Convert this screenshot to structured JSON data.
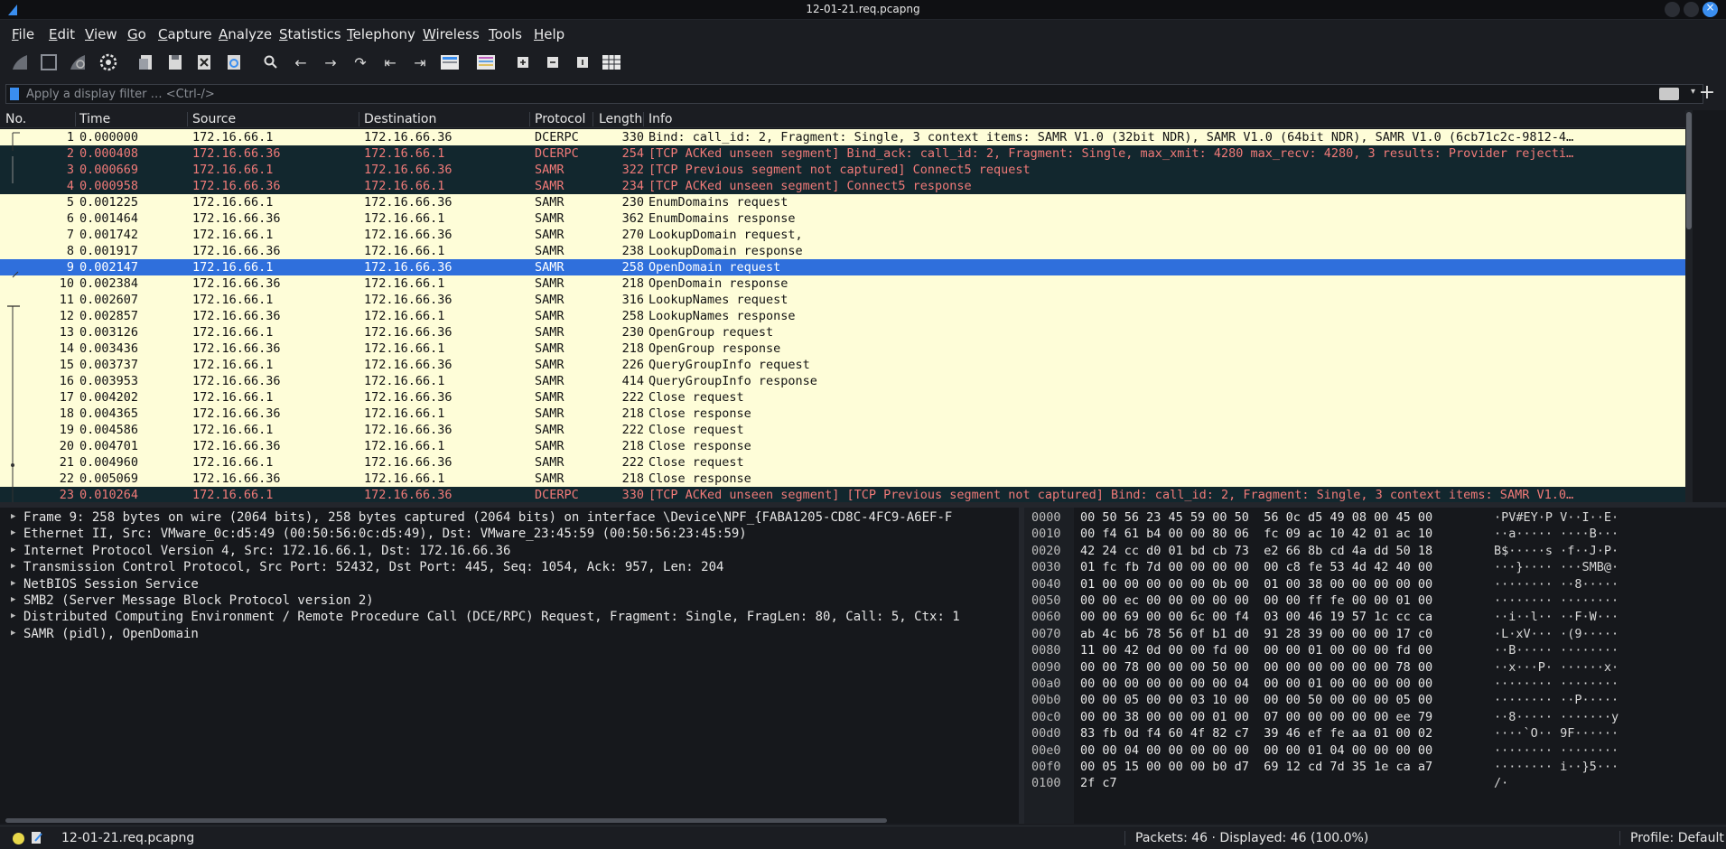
{
  "window": {
    "title": "12-01-21.req.pcapng"
  },
  "menu": [
    "File",
    "Edit",
    "View",
    "Go",
    "Capture",
    "Analyze",
    "Statistics",
    "Telephony",
    "Wireless",
    "Tools",
    "Help"
  ],
  "toolbar": {
    "icons": [
      "shark-fin-start-icon",
      "stop-square-icon",
      "shark-fin-restart-icon",
      "gear-options-icon",
      "open-file-icon",
      "save-file-icon",
      "close-file-icon",
      "reload-file-icon",
      "find-packet-icon",
      "back-arrow-icon",
      "forward-arrow-icon",
      "goto-packet-icon",
      "first-packet-icon",
      "last-packet-icon",
      "autoscroll-icon",
      "colorize-icon",
      "zoom-in-icon",
      "zoom-out-icon",
      "normal-size-icon",
      "resize-columns-icon"
    ]
  },
  "filter": {
    "placeholder": "Apply a display filter … <Ctrl-/>",
    "value": ""
  },
  "columns": [
    "No.",
    "Time",
    "Source",
    "Destination",
    "Protocol",
    "Length",
    "Info"
  ],
  "packets": [
    {
      "no": "1",
      "time": "0.000000",
      "src": "172.16.66.1",
      "dst": "172.16.66.36",
      "proto": "DCERPC",
      "len": "330",
      "info": "Bind: call_id: 2, Fragment: Single, 3 context items: SAMR V1.0 (32bit NDR), SAMR V1.0 (64bit NDR), SAMR V1.0 (6cb71c2c-9812-4…",
      "style": "yellow"
    },
    {
      "no": "2",
      "time": "0.000408",
      "src": "172.16.66.36",
      "dst": "172.16.66.1",
      "proto": "DCERPC",
      "len": "254",
      "info": "[TCP ACKed unseen segment] Bind_ack: call_id: 2, Fragment: Single, max_xmit: 4280 max_recv: 4280, 3 results: Provider rejecti…",
      "style": "dark"
    },
    {
      "no": "3",
      "time": "0.000669",
      "src": "172.16.66.1",
      "dst": "172.16.66.36",
      "proto": "SAMR",
      "len": "322",
      "info": "[TCP Previous segment not captured] Connect5 request",
      "style": "dark"
    },
    {
      "no": "4",
      "time": "0.000958",
      "src": "172.16.66.36",
      "dst": "172.16.66.1",
      "proto": "SAMR",
      "len": "234",
      "info": "[TCP ACKed unseen segment] Connect5 response",
      "style": "dark"
    },
    {
      "no": "5",
      "time": "0.001225",
      "src": "172.16.66.1",
      "dst": "172.16.66.36",
      "proto": "SAMR",
      "len": "230",
      "info": "EnumDomains request",
      "style": "yellow"
    },
    {
      "no": "6",
      "time": "0.001464",
      "src": "172.16.66.36",
      "dst": "172.16.66.1",
      "proto": "SAMR",
      "len": "362",
      "info": "EnumDomains response",
      "style": "yellow"
    },
    {
      "no": "7",
      "time": "0.001742",
      "src": "172.16.66.1",
      "dst": "172.16.66.36",
      "proto": "SAMR",
      "len": "270",
      "info": "LookupDomain request,",
      "style": "yellow"
    },
    {
      "no": "8",
      "time": "0.001917",
      "src": "172.16.66.36",
      "dst": "172.16.66.1",
      "proto": "SAMR",
      "len": "238",
      "info": "LookupDomain response",
      "style": "yellow"
    },
    {
      "no": "9",
      "time": "0.002147",
      "src": "172.16.66.1",
      "dst": "172.16.66.36",
      "proto": "SAMR",
      "len": "258",
      "info": "OpenDomain request",
      "style": "selected"
    },
    {
      "no": "10",
      "time": "0.002384",
      "src": "172.16.66.36",
      "dst": "172.16.66.1",
      "proto": "SAMR",
      "len": "218",
      "info": "OpenDomain response",
      "style": "yellow"
    },
    {
      "no": "11",
      "time": "0.002607",
      "src": "172.16.66.1",
      "dst": "172.16.66.36",
      "proto": "SAMR",
      "len": "316",
      "info": "LookupNames request",
      "style": "yellow"
    },
    {
      "no": "12",
      "time": "0.002857",
      "src": "172.16.66.36",
      "dst": "172.16.66.1",
      "proto": "SAMR",
      "len": "258",
      "info": "LookupNames response",
      "style": "yellow"
    },
    {
      "no": "13",
      "time": "0.003126",
      "src": "172.16.66.1",
      "dst": "172.16.66.36",
      "proto": "SAMR",
      "len": "230",
      "info": "OpenGroup request",
      "style": "yellow"
    },
    {
      "no": "14",
      "time": "0.003436",
      "src": "172.16.66.36",
      "dst": "172.16.66.1",
      "proto": "SAMR",
      "len": "218",
      "info": "OpenGroup response",
      "style": "yellow"
    },
    {
      "no": "15",
      "time": "0.003737",
      "src": "172.16.66.1",
      "dst": "172.16.66.36",
      "proto": "SAMR",
      "len": "226",
      "info": "QueryGroupInfo request",
      "style": "yellow"
    },
    {
      "no": "16",
      "time": "0.003953",
      "src": "172.16.66.36",
      "dst": "172.16.66.1",
      "proto": "SAMR",
      "len": "414",
      "info": "QueryGroupInfo response",
      "style": "yellow"
    },
    {
      "no": "17",
      "time": "0.004202",
      "src": "172.16.66.1",
      "dst": "172.16.66.36",
      "proto": "SAMR",
      "len": "222",
      "info": "Close request",
      "style": "yellow"
    },
    {
      "no": "18",
      "time": "0.004365",
      "src": "172.16.66.36",
      "dst": "172.16.66.1",
      "proto": "SAMR",
      "len": "218",
      "info": "Close response",
      "style": "yellow"
    },
    {
      "no": "19",
      "time": "0.004586",
      "src": "172.16.66.1",
      "dst": "172.16.66.36",
      "proto": "SAMR",
      "len": "222",
      "info": "Close request",
      "style": "yellow"
    },
    {
      "no": "20",
      "time": "0.004701",
      "src": "172.16.66.36",
      "dst": "172.16.66.1",
      "proto": "SAMR",
      "len": "218",
      "info": "Close response",
      "style": "yellow"
    },
    {
      "no": "21",
      "time": "0.004960",
      "src": "172.16.66.1",
      "dst": "172.16.66.36",
      "proto": "SAMR",
      "len": "222",
      "info": "Close request",
      "style": "yellow"
    },
    {
      "no": "22",
      "time": "0.005069",
      "src": "172.16.66.36",
      "dst": "172.16.66.1",
      "proto": "SAMR",
      "len": "218",
      "info": "Close response",
      "style": "yellow"
    },
    {
      "no": "23",
      "time": "0.010264",
      "src": "172.16.66.1",
      "dst": "172.16.66.36",
      "proto": "DCERPC",
      "len": "330",
      "info": "[TCP ACKed unseen segment] [TCP Previous segment not captured] Bind: call_id: 2, Fragment: Single, 3 context items: SAMR V1.0…",
      "style": "dark"
    }
  ],
  "details": [
    "Frame 9: 258 bytes on wire (2064 bits), 258 bytes captured (2064 bits) on interface \\Device\\NPF_{FABA1205-CD8C-4FC9-A6EF-F",
    "Ethernet II, Src: VMware_0c:d5:49 (00:50:56:0c:d5:49), Dst: VMware_23:45:59 (00:50:56:23:45:59)",
    "Internet Protocol Version 4, Src: 172.16.66.1, Dst: 172.16.66.36",
    "Transmission Control Protocol, Src Port: 52432, Dst Port: 445, Seq: 1054, Ack: 957, Len: 204",
    "NetBIOS Session Service",
    "SMB2 (Server Message Block Protocol version 2)",
    "Distributed Computing Environment / Remote Procedure Call (DCE/RPC) Request, Fragment: Single, FragLen: 80, Call: 5, Ctx: 1",
    "SAMR (pidl), OpenDomain"
  ],
  "hex": [
    {
      "off": "0000",
      "hex": "00 50 56 23 45 59 00 50  56 0c d5 49 08 00 45 00",
      "asc": "·PV#EY·P V··I··E·"
    },
    {
      "off": "0010",
      "hex": "00 f4 61 b4 00 00 80 06  fc 09 ac 10 42 01 ac 10",
      "asc": "··a····· ····B···"
    },
    {
      "off": "0020",
      "hex": "42 24 cc d0 01 bd cb 73  e2 66 8b cd 4a dd 50 18",
      "asc": "B$·····s ·f··J·P·"
    },
    {
      "off": "0030",
      "hex": "01 fc fb 7d 00 00 00 00  00 c8 fe 53 4d 42 40 00",
      "asc": "···}···· ···SMB@·"
    },
    {
      "off": "0040",
      "hex": "01 00 00 00 00 00 0b 00  01 00 38 00 00 00 00 00",
      "asc": "········ ··8·····"
    },
    {
      "off": "0050",
      "hex": "00 00 ec 00 00 00 00 00  00 00 ff fe 00 00 01 00",
      "asc": "········ ········"
    },
    {
      "off": "0060",
      "hex": "00 00 69 00 00 6c 00 f4  03 00 46 19 57 1c cc ca",
      "asc": "··i··l·· ··F·W···"
    },
    {
      "off": "0070",
      "hex": "ab 4c b6 78 56 0f b1 d0  91 28 39 00 00 00 17 c0",
      "asc": "·L·xV··· ·(9·····"
    },
    {
      "off": "0080",
      "hex": "11 00 42 0d 00 00 fd 00  00 00 01 00 00 00 fd 00",
      "asc": "··B····· ········"
    },
    {
      "off": "0090",
      "hex": "00 00 78 00 00 00 50 00  00 00 00 00 00 00 78 00",
      "asc": "··x···P· ······x·"
    },
    {
      "off": "00a0",
      "hex": "00 00 00 00 00 00 00 04  00 00 01 00 00 00 00 00",
      "asc": "········ ········"
    },
    {
      "off": "00b0",
      "hex": "00 00 05 00 00 03 10 00  00 00 50 00 00 00 05 00",
      "asc": "········ ··P·····"
    },
    {
      "off": "00c0",
      "hex": "00 00 38 00 00 00 01 00  07 00 00 00 00 00 ee 79",
      "asc": "··8····· ·······y"
    },
    {
      "off": "00d0",
      "hex": "83 fb 0d f4 60 4f 82 c7  39 46 ef fe aa 01 00 02",
      "asc": "····`O·· 9F······"
    },
    {
      "off": "00e0",
      "hex": "00 00 04 00 00 00 00 00  00 00 01 04 00 00 00 00",
      "asc": "········ ········"
    },
    {
      "off": "00f0",
      "hex": "00 05 15 00 00 00 b0 d7  69 12 cd 7d 35 1e ca a7",
      "asc": "········ i··}5···"
    },
    {
      "off": "0100",
      "hex": "2f c7",
      "asc": "/·"
    }
  ],
  "status": {
    "file": "12-01-21.req.pcapng",
    "packets": "Packets: 46 · Displayed: 46 (100.0%)",
    "profile": "Profile: Default"
  },
  "colors": {
    "accent": "#3a8ef0",
    "row_yellow": "#fefdd8",
    "row_dark": "#12272e",
    "row_dark_text": "#f07a78",
    "selected": "#2f6fdc"
  }
}
